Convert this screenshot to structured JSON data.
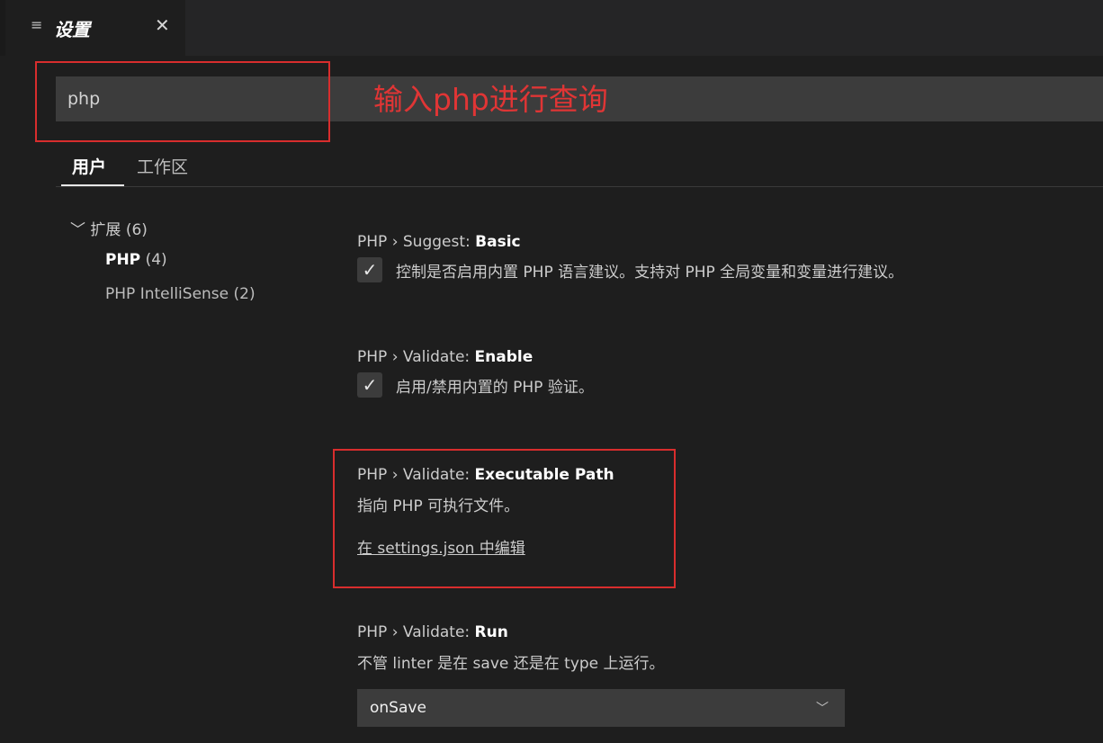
{
  "tab": {
    "icon": "list-icon",
    "title": "设置",
    "close": "✕"
  },
  "search": {
    "value": "php"
  },
  "annotation": {
    "text": "输入php进行查询",
    "color": "#d82d2d"
  },
  "scope_tabs": [
    {
      "label": "用户",
      "active": true
    },
    {
      "label": "工作区",
      "active": false
    }
  ],
  "toc": {
    "extensions": {
      "label": "扩展",
      "count": "(6)"
    },
    "items": [
      {
        "label": "PHP",
        "count": "(4)",
        "selected": true
      },
      {
        "label": "PHP IntelliSense",
        "count": "(2)",
        "selected": false
      }
    ]
  },
  "settings": [
    {
      "prefix": "PHP › Suggest: ",
      "name": "Basic",
      "description": "控制是否启用内置 PHP 语言建议。支持对 PHP 全局变量和变量进行建议。",
      "checked": true
    },
    {
      "prefix": "PHP › Validate: ",
      "name": "Enable",
      "description": "启用/禁用内置的 PHP 验证。",
      "checked": true
    },
    {
      "prefix": "PHP › Validate: ",
      "name": "Executable Path",
      "description": "指向 PHP 可执行文件。",
      "link": "在 settings.json 中编辑"
    },
    {
      "prefix": "PHP › Validate: ",
      "name": "Run",
      "description": "不管 linter 是在 save 还是在 type 上运行。",
      "selected_option": "onSave"
    }
  ]
}
